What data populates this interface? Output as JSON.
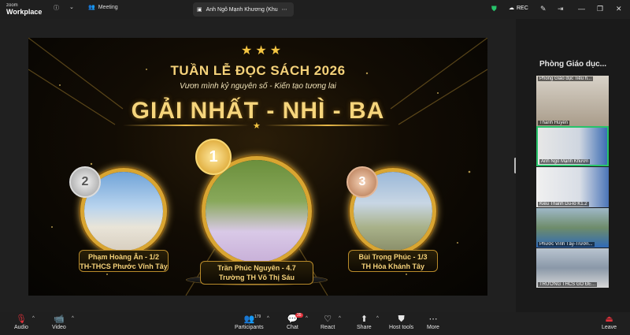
{
  "app": {
    "logo_line1": "zoom",
    "logo_line2": "Workplace",
    "meeting_label": "Meeting",
    "share_title": "Anh Ngô Mạnh Khương (Khu",
    "rec_label": "REC"
  },
  "slide": {
    "title": "TUẦN LỄ ĐỌC SÁCH 2026",
    "subtitle": "Vươn mình kỷ nguyên số - Kiến tạo tương lai",
    "big_title": "GIẢI NHẤT - NHÌ - BA",
    "winners": [
      {
        "rank": "1",
        "name": "Trần Phúc Nguyên - 4.7",
        "school": "Trường TH Võ Thị Sáu"
      },
      {
        "rank": "2",
        "name": "Phạm Hoàng Ân - 1/2",
        "school": "TH-THCS Phước Vĩnh Tây"
      },
      {
        "rank": "3",
        "name": "Bùi Trọng Phúc - 1/3",
        "school": "TH Hòa Khánh Tây"
      }
    ]
  },
  "panel": {
    "title": "Phòng Giáo dục...",
    "tiles": [
      {
        "top_caption": "Phòng Giáo dục Tiểu h...",
        "caption": "Thanh Huyền"
      },
      {
        "caption": "Anh Ngô Mạnh Khươn"
      },
      {
        "caption": "Kiều Thanh Dũ-lò K1.2"
      },
      {
        "caption": "Phước Vĩnh Tây-Trườn..."
      },
      {
        "caption": "TRƯỜNG THCS GÒ ĐE..."
      }
    ]
  },
  "toolbar": {
    "audio": "Audio",
    "video": "Video",
    "participants": "Participants",
    "participants_count": "179",
    "chat": "Chat",
    "chat_badge": "35",
    "react": "React",
    "share": "Share",
    "host_tools": "Host tools",
    "more": "More",
    "leave": "Leave"
  },
  "colors": {
    "gold": "#f5d27a",
    "active_tile": "#27c36a",
    "leave_red": "#e0303a"
  }
}
